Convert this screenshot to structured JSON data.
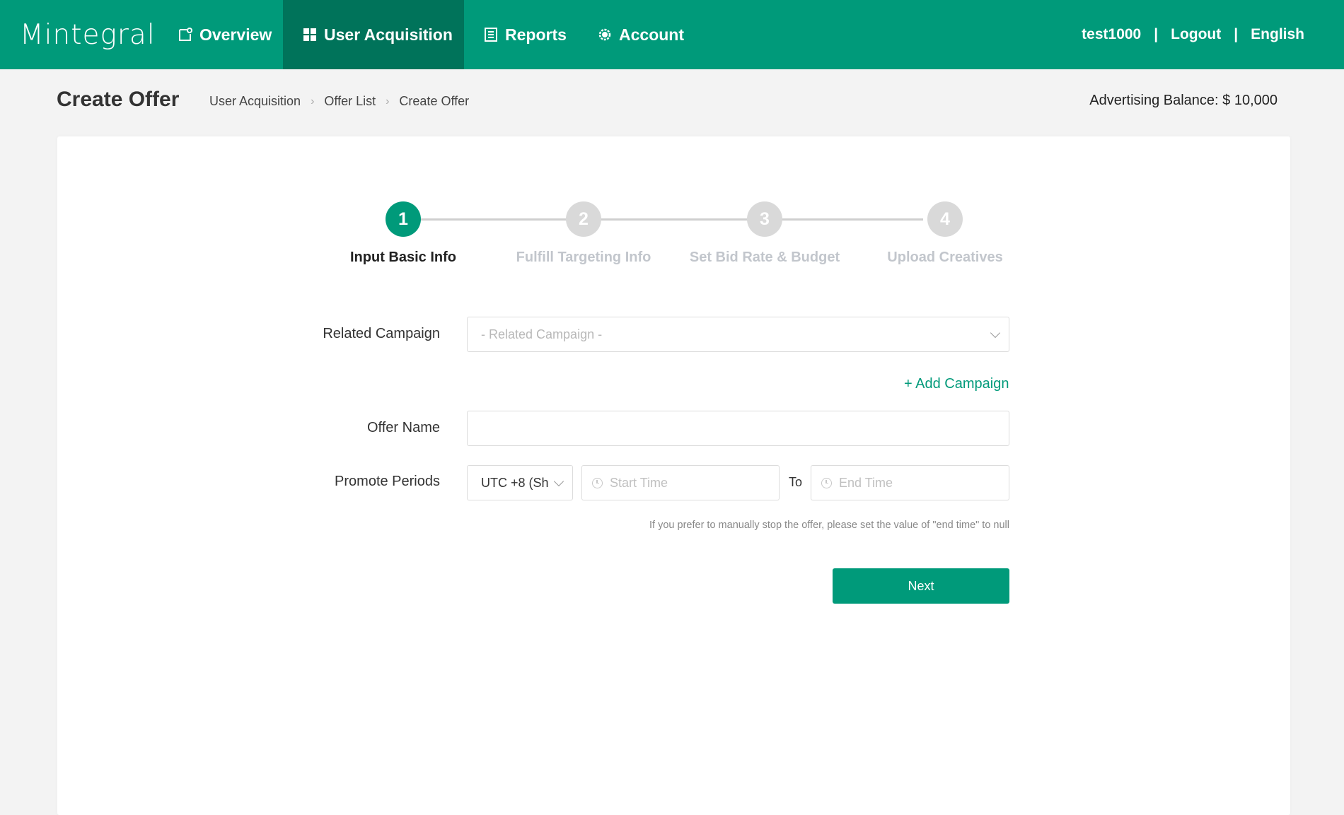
{
  "brand": {
    "logo_text": "Mintegral",
    "primary_color": "#009a7a",
    "active_nav_color": "#00735a"
  },
  "nav": {
    "items": [
      {
        "label": "Overview",
        "icon": "overview-icon",
        "active": false
      },
      {
        "label": "User Acquisition",
        "icon": "grid-icon",
        "active": true
      },
      {
        "label": "Reports",
        "icon": "report-icon",
        "active": false
      },
      {
        "label": "Account",
        "icon": "gear-icon",
        "active": false
      }
    ],
    "username": "test1000",
    "logout": "Logout",
    "language": "English",
    "separator": "|"
  },
  "header": {
    "title": "Create Offer",
    "breadcrumb": [
      "User Acquisition",
      "Offer List",
      "Create Offer"
    ],
    "balance": "Advertising Balance: $ 10,000"
  },
  "steps": [
    {
      "number": "1",
      "label": "Input Basic Info",
      "active": true
    },
    {
      "number": "2",
      "label": "Fulfill Targeting Info",
      "active": false
    },
    {
      "number": "3",
      "label": "Set Bid Rate & Budget",
      "active": false
    },
    {
      "number": "4",
      "label": "Upload Creatives",
      "active": false
    }
  ],
  "form": {
    "related_campaign": {
      "label": "Related Campaign",
      "placeholder": "- Related Campaign -"
    },
    "add_campaign": "+ Add Campaign",
    "offer_name": {
      "label": "Offer Name",
      "value": ""
    },
    "promote_periods": {
      "label": "Promote Periods",
      "timezone": "UTC +8 (Sh",
      "start_placeholder": "Start Time",
      "to": "To",
      "end_placeholder": "End Time",
      "hint": "If you prefer to manually stop the offer, please set the value of \"end time\" to null"
    },
    "next_button": "Next"
  }
}
